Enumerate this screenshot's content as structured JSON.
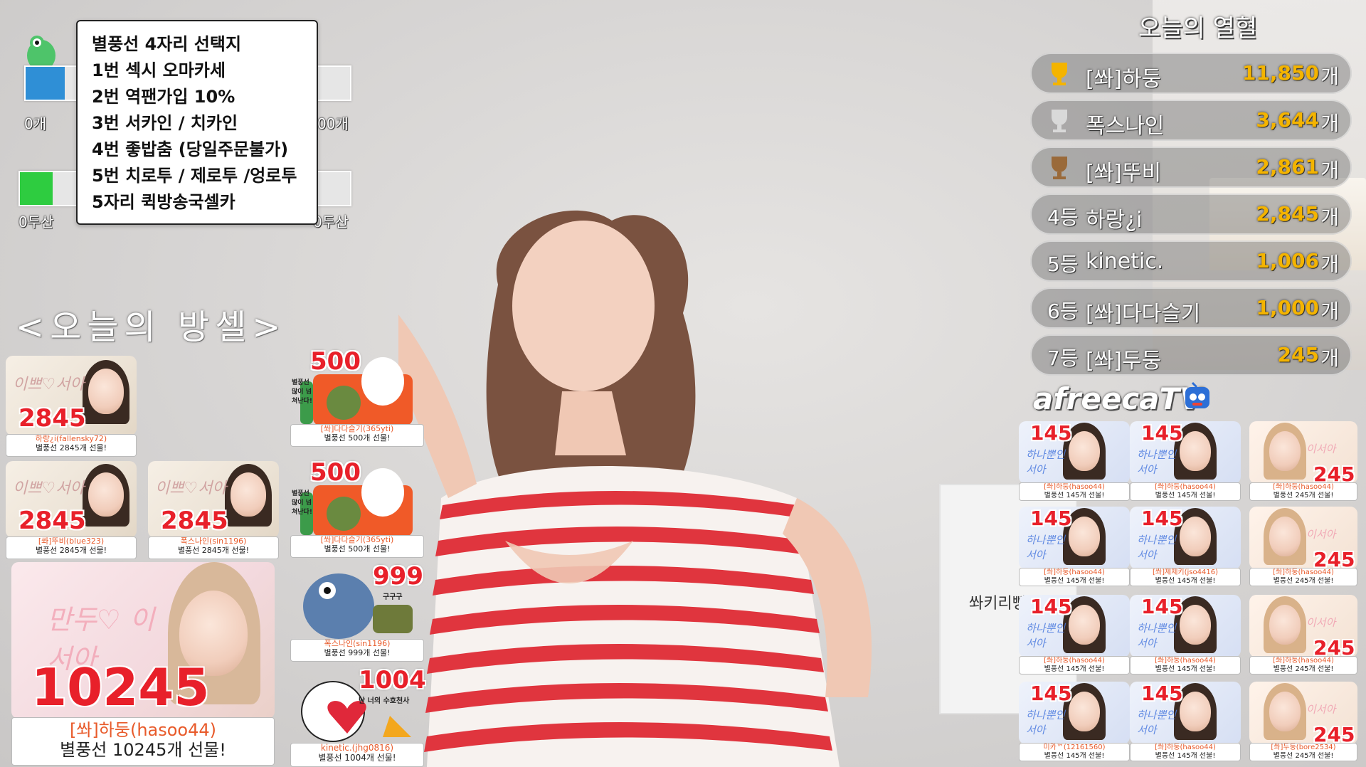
{
  "memo": {
    "lines": [
      "별풍선 4자리 선택지",
      "1번 섹시 오마카세",
      "2번 역팬가입 10%",
      "3번 서카인 / 치카인",
      "4번 좋밥춤 (당일주문불가)",
      "5번 치로투 / 제로투 /엉로투",
      "5자리 퀵방송국셀카"
    ]
  },
  "goal_bars": {
    "top_left_label": "0개",
    "top_right_label": "00개",
    "bottom_left_label": "0두산",
    "bottom_right_label": "0두산",
    "bottom_fill_fraction": 0.1
  },
  "bangsel": {
    "title": "<오늘의 방셀>"
  },
  "ranking": {
    "title": "오늘의 열혈",
    "unit": "개",
    "rows": [
      {
        "pos": "",
        "name": "[쏴]하둥",
        "value": "11,850",
        "trophy": "gold"
      },
      {
        "pos": "",
        "name": "폭스나인",
        "value": "3,644",
        "trophy": "silver"
      },
      {
        "pos": "",
        "name": "[쏴]뚜비",
        "value": "2,861",
        "trophy": "bronze"
      },
      {
        "pos": "4등",
        "name": "하랑¿i",
        "value": "2,845",
        "trophy": ""
      },
      {
        "pos": "5등",
        "name": "kinetic.",
        "value": "1,006",
        "trophy": ""
      },
      {
        "pos": "6등",
        "name": "[쏴]다다슬기",
        "value": "1,000",
        "trophy": ""
      },
      {
        "pos": "7등",
        "name": "[쏴]두둥",
        "value": "245",
        "trophy": ""
      }
    ]
  },
  "brand": {
    "logo_text": "afreecaTV"
  },
  "left_cards": [
    {
      "count": "2845",
      "script": "이쁘♡서아",
      "user": "하랑¿i(fallensky72)",
      "msg": "별풍선 2845개 선물!"
    },
    {
      "count": "2845",
      "script": "이쁘♡서아",
      "user": "[쏴]뚜비(blue323)",
      "msg": "별풍선 2845개 선물!"
    },
    {
      "count": "2845",
      "script": "이쁘♡서아",
      "user": "폭스나인(sin1196)",
      "msg": "별풍선 2845개 선물!"
    }
  ],
  "big_card": {
    "count": "10245",
    "script": "만두♡ 이서아",
    "user": "[쏴]하둥(hasoo44)",
    "msg": "별풍선 10245개 선물!"
  },
  "stickers": [
    {
      "count": "500",
      "text": "별풍선 많이 넘쳐난다!",
      "user": "[쏴]다다슬기(365yti)",
      "msg": "별풍선 500개 선물!"
    },
    {
      "count": "500",
      "text": "별풍선 많이 넘쳐난다!",
      "user": "[쏴]다다슬기(365yti)",
      "msg": "별풍선 500개 선물!"
    },
    {
      "count": "999",
      "text": "구구구",
      "user": "폭스나인(sin1196)",
      "msg": "별풍선 999개 선물!"
    },
    {
      "count": "1004",
      "text": "난 너의 수호천사",
      "user": "kinetic.(jhg0816)",
      "msg": "별풍선 1004개 선물!"
    }
  ],
  "right_cards": [
    {
      "count": "145",
      "script": "하나뿐인 서아",
      "user": "[쏴]하둥(hasoo44)",
      "msg": "별풍선 145개 선물!"
    },
    {
      "count": "145",
      "script": "하나뿐인 서아",
      "user": "[쏴]하둥(hasoo44)",
      "msg": "별풍선 145개 선물!"
    },
    {
      "count": "245",
      "script": "이서아",
      "user": "[쏴]하둥(hasoo44)",
      "msg": "별풍선 245개 선물!"
    },
    {
      "count": "145",
      "script": "하나뿐인 서아",
      "user": "[쏴]하둥(hasoo44)",
      "msg": "별풍선 145개 선물!"
    },
    {
      "count": "145",
      "script": "하나뿐인 서아",
      "user": "[쏴]제제키(jso4416)",
      "msg": "별풍선 145개 선물!"
    },
    {
      "count": "245",
      "script": "이서아",
      "user": "[쏴]하둥(hasoo44)",
      "msg": "별풍선 245개 선물!"
    },
    {
      "count": "145",
      "script": "하나뿐인 서아",
      "user": "[쏴]하둥(hasoo44)",
      "msg": "별풍선 145개 선물!"
    },
    {
      "count": "145",
      "script": "하나뿐인 서아",
      "user": "[쏴]하둥(hasoo44)",
      "msg": "별풍선 145개 선물!"
    },
    {
      "count": "245",
      "script": "이서아",
      "user": "[쏴]하둥(hasoo44)",
      "msg": "별풍선 245개 선물!"
    },
    {
      "count": "145",
      "script": "하나뿐인 서아",
      "user": "미카™(12161560)",
      "msg": "별풍선 145개 선물!"
    },
    {
      "count": "145",
      "script": "하나뿐인 서아",
      "user": "[쏴]하둥(hasoo44)",
      "msg": "별풍선 145개 선물!"
    },
    {
      "count": "245",
      "script": "이서아",
      "user": "[쏴]두둥(bore2534)",
      "msg": "별풍선 245개 선물!"
    }
  ],
  "background_text": {
    "wall_sign": "쏴키리빵붐?"
  },
  "colors": {
    "accent_red": "#e8202a",
    "gold": "#f4b400",
    "bar_green": "#2ecc40"
  }
}
